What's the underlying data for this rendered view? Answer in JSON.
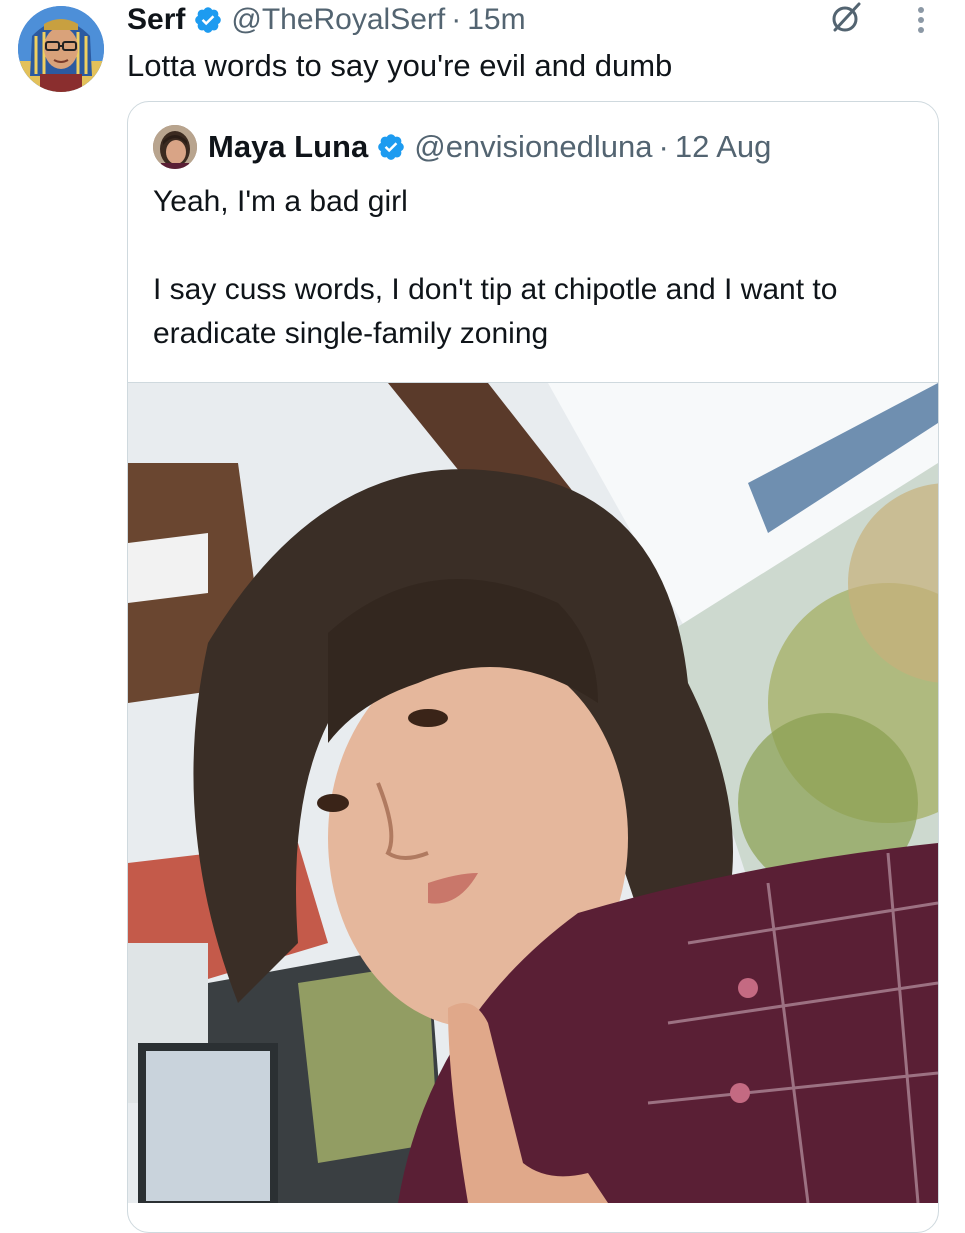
{
  "tweet": {
    "display_name": "Serf",
    "handle": "@TheRoyalSerf",
    "separator": "·",
    "timestamp": "15m",
    "text": "Lotta words to say you're evil and dumb"
  },
  "quote": {
    "display_name": "Maya Luna",
    "handle": "@envisionedluna",
    "separator": "·",
    "date": "12 Aug",
    "text_line1": "Yeah, I'm a bad girl",
    "text_line2": "I say cuss words, I don't tip at chipotle and I want to eradicate single-family zoning"
  },
  "icons": {
    "verified": "verified-badge-icon",
    "grok": "grok-icon",
    "more": "more-options-icon"
  },
  "colors": {
    "accent": "#1d9bf0",
    "text_primary": "#0f1419",
    "text_secondary": "#536471",
    "border": "#cfd9de"
  }
}
